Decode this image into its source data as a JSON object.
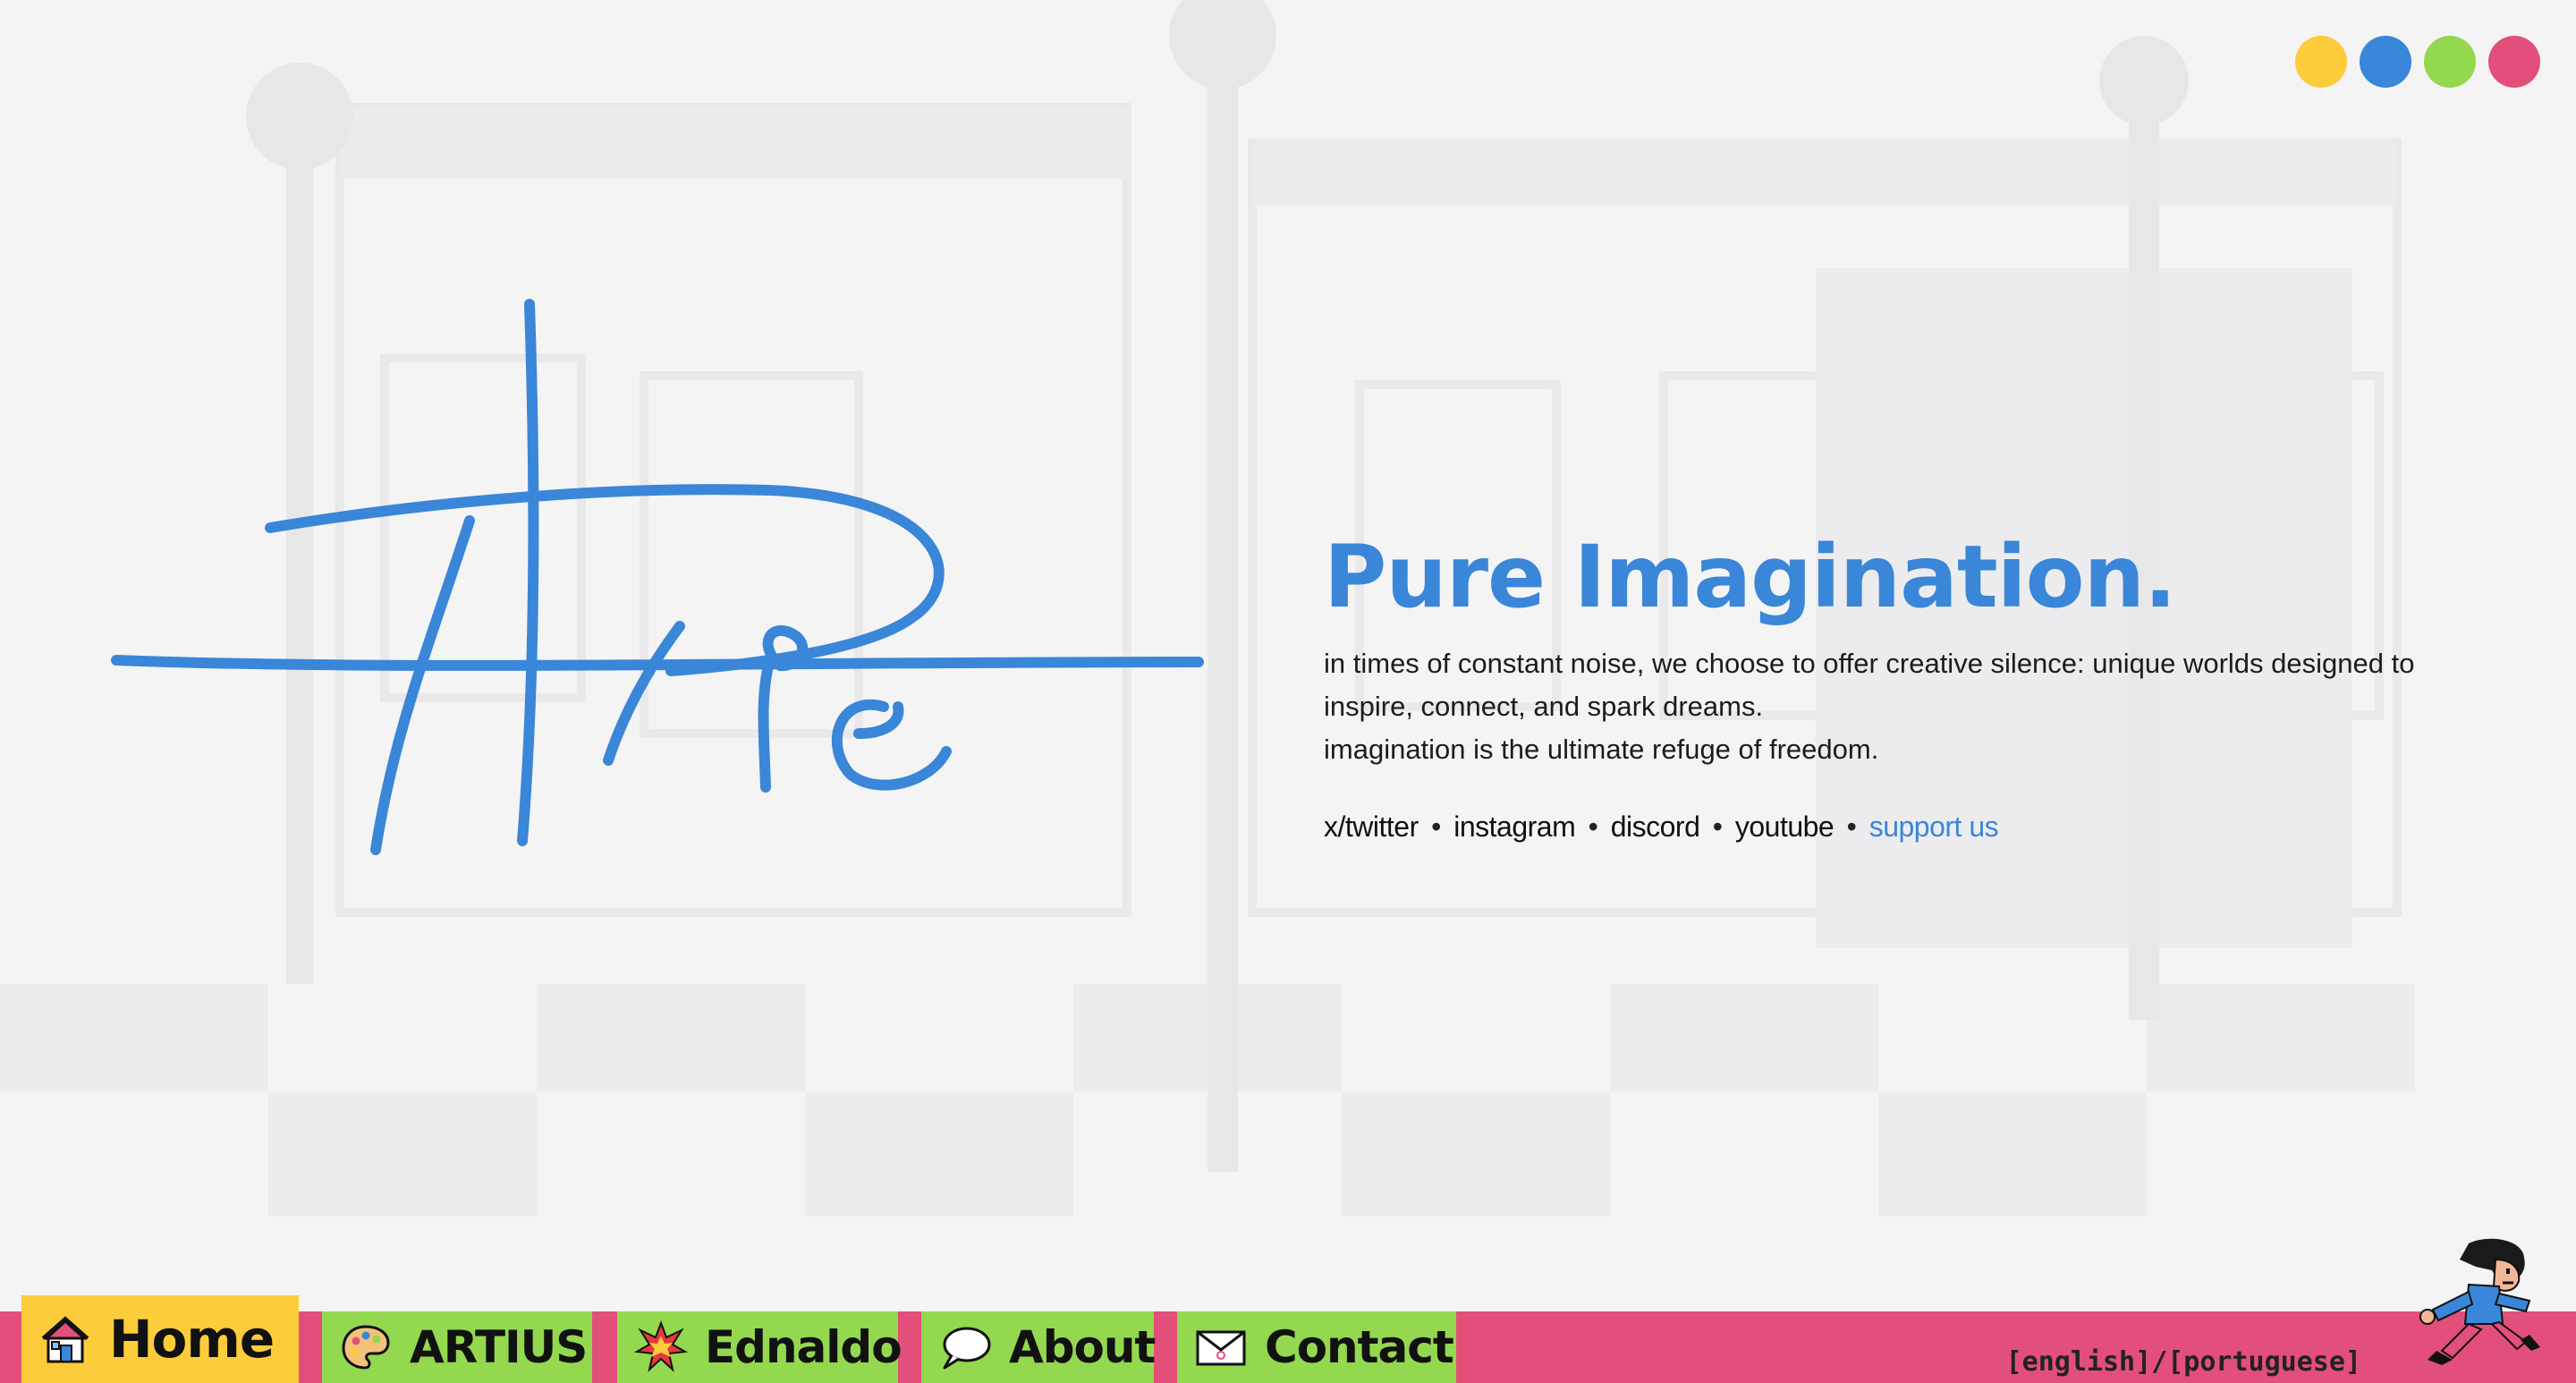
{
  "theme_colors": [
    {
      "name": "yellow",
      "hex": "#fdcc3b"
    },
    {
      "name": "blue",
      "hex": "#3a86d8"
    },
    {
      "name": "green",
      "hex": "#93d84f"
    },
    {
      "name": "pink",
      "hex": "#e24f7a"
    }
  ],
  "hero": {
    "title": "Pure Imagination.",
    "desc_line1": "in times of constant noise, we choose to offer creative silence: unique worlds designed to inspire, connect, and spark dreams.",
    "desc_line2": "imagination is the ultimate refuge of freedom."
  },
  "socials": {
    "twitter": "x/twitter",
    "instagram": "instagram",
    "discord": "discord",
    "youtube": "youtube",
    "support": "support us",
    "separator": "•"
  },
  "nav": {
    "home": {
      "label": "Home",
      "icon": "house-icon"
    },
    "artius": {
      "label": "ARTIUS",
      "icon": "palette-icon"
    },
    "ednaldo": {
      "label": "Ednaldo",
      "icon": "explosion-icon"
    },
    "about": {
      "label": "About",
      "icon": "speech-bubble-icon"
    },
    "contact": {
      "label": "Contact",
      "icon": "envelope-icon"
    }
  },
  "language": {
    "english": "[english]",
    "slash": "/",
    "portuguese": "[portuguese]"
  }
}
